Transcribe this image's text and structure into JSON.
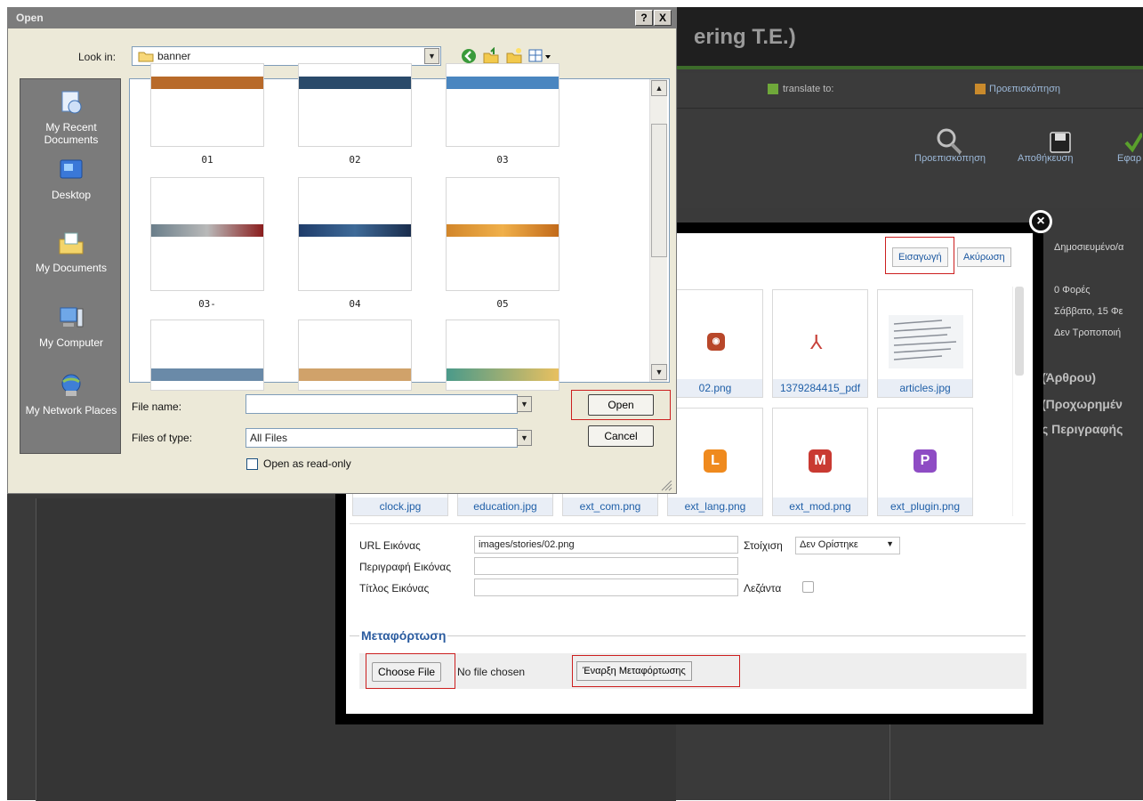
{
  "background": {
    "header_title_fragment": "ering T.E.)",
    "translate_label": "translate to:",
    "preview_link": "Προεπισκόπηση",
    "toolbar_buttons": [
      "Προεπισκόπηση",
      "Αποθήκευση",
      "Εφαρ"
    ],
    "right_panel": {
      "published": "Δημοσιευμένο/α",
      "hits": "0 Φορές",
      "date": "Σάββατο, 15 Φε",
      "modified": "Δεν Τροποποιή",
      "section1": "(Άρθρου)",
      "section2": "(Προχωρημέν",
      "section3": "ς Περιγραφής"
    }
  },
  "modal": {
    "insert_label": "Εισαγωγή",
    "cancel_label": "Ακύρωση",
    "grid_row1": [
      "02.png",
      "1379284415_pdf",
      "articles.jpg"
    ],
    "grid_row2": [
      "clock.jpg",
      "education.jpg",
      "ext_com.png",
      "ext_lang.png",
      "ext_mod.png",
      "ext_plugin.png"
    ],
    "file_icons": {
      "rss": "rss-icon",
      "pdf": "pdf-icon",
      "lang": "L",
      "mod": "M",
      "plugin": "P"
    },
    "url_label": "URL Εικόνας",
    "url_value": "images/stories/02.png",
    "align_label": "Στοίχιση",
    "align_value": "Δεν Ορίστηκε",
    "desc_label": "Περιγραφή Εικόνας",
    "title_label": "Τίτλος Εικόνας",
    "caption_label": "Λεζάντα",
    "upload_legend": "Μεταφόρτωση",
    "choose_file": "Choose File",
    "no_file": "No file chosen",
    "start_upload": "Έναρξη Μεταφόρτωσης",
    "accent": "#cc1f1f"
  },
  "dialog": {
    "title": "Open",
    "help_btn": "?",
    "close_btn": "X",
    "look_in_label": "Look in:",
    "look_in_value": "banner",
    "places": [
      "My Recent Documents",
      "Desktop",
      "My Documents",
      "My Computer",
      "My Network Places"
    ],
    "files": [
      "01",
      "02",
      "03",
      "03-",
      "04",
      "05"
    ],
    "file_name_label": "File name:",
    "file_name_value": "",
    "files_of_type_label": "Files of type:",
    "files_of_type_value": "All Files",
    "readonly_label": "Open as read-only",
    "open_label": "Open",
    "cancel_label": "Cancel"
  }
}
